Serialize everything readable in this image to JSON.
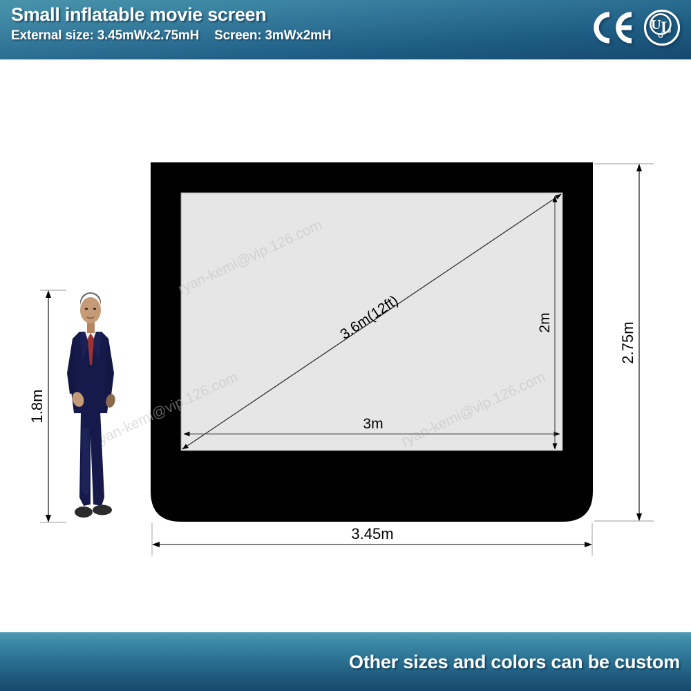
{
  "header": {
    "title": "Small inflatable movie screen",
    "subtitle_external": "External size: 3.45mWx2.75mH",
    "subtitle_screen": "Screen: 3mWx2mH",
    "certifications": [
      "CE",
      "UL"
    ],
    "ul_letters": "UL",
    "bg_color_top": "#4a93ab",
    "bg_color_bottom": "#17496e",
    "text_color": "#ffffff"
  },
  "diagram": {
    "frame_color": "#000000",
    "screen_color": "#e6e6e6",
    "dimension_line_color": "#000000",
    "labels": {
      "person_height": "1.8m",
      "screen_width": "3m",
      "screen_height": "2m",
      "screen_diagonal": "3.6m(12ft)",
      "external_width": "3.45m",
      "external_height": "2.75m"
    },
    "watermark": "ryan-kemi@vip.126.com",
    "watermark_color": "#c8c8c8"
  },
  "person": {
    "description": "man-in-navy-suit",
    "suit_color": "#161a4a",
    "tie_color": "#9c3232",
    "shirt_color": "#f2f2f2",
    "skin_color": "#c49a77",
    "hair_color": "#6b6b6b",
    "shoe_color": "#2b2b2b"
  },
  "footer": {
    "text": "Other sizes and colors can be custom",
    "bg_color_top": "#4c9ab3",
    "bg_color_bottom": "#18496b",
    "text_color": "#ffffff"
  }
}
